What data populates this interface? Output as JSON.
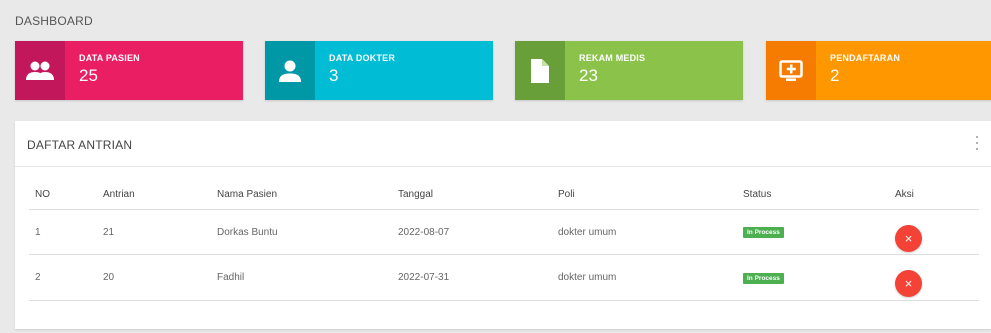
{
  "page": {
    "title": "DASHBOARD"
  },
  "cards": [
    {
      "label": "DATA PASIEN",
      "value": "25",
      "icon": "group-icon",
      "color": "#e91e63",
      "icon_bg": "#c2185b"
    },
    {
      "label": "DATA DOKTER",
      "value": "3",
      "icon": "person-icon",
      "color": "#00bcd4",
      "icon_bg": "#0097a7"
    },
    {
      "label": "REKAM MEDIS",
      "value": "23",
      "icon": "document-icon",
      "color": "#8bc34a",
      "icon_bg": "#689f38"
    },
    {
      "label": "PENDAFTARAN",
      "value": "2",
      "icon": "add-to-queue-icon",
      "color": "#ff9800",
      "icon_bg": "#f57c00"
    }
  ],
  "panel": {
    "title": "DAFTAR ANTRIAN"
  },
  "table": {
    "headers": [
      "NO",
      "Antrian",
      "Nama Pasien",
      "Tanggal",
      "Poli",
      "Status",
      "Aksi"
    ],
    "rows": [
      {
        "no": "1",
        "antrian": "21",
        "nama": "Dorkas Buntu",
        "tanggal": "2022-08-07",
        "poli": "dokter umum",
        "status": "In Process",
        "aksi": "×"
      },
      {
        "no": "2",
        "antrian": "20",
        "nama": "Fadhil",
        "tanggal": "2022-07-31",
        "poli": "dokter umum",
        "status": "In Process",
        "aksi": "×"
      }
    ]
  }
}
